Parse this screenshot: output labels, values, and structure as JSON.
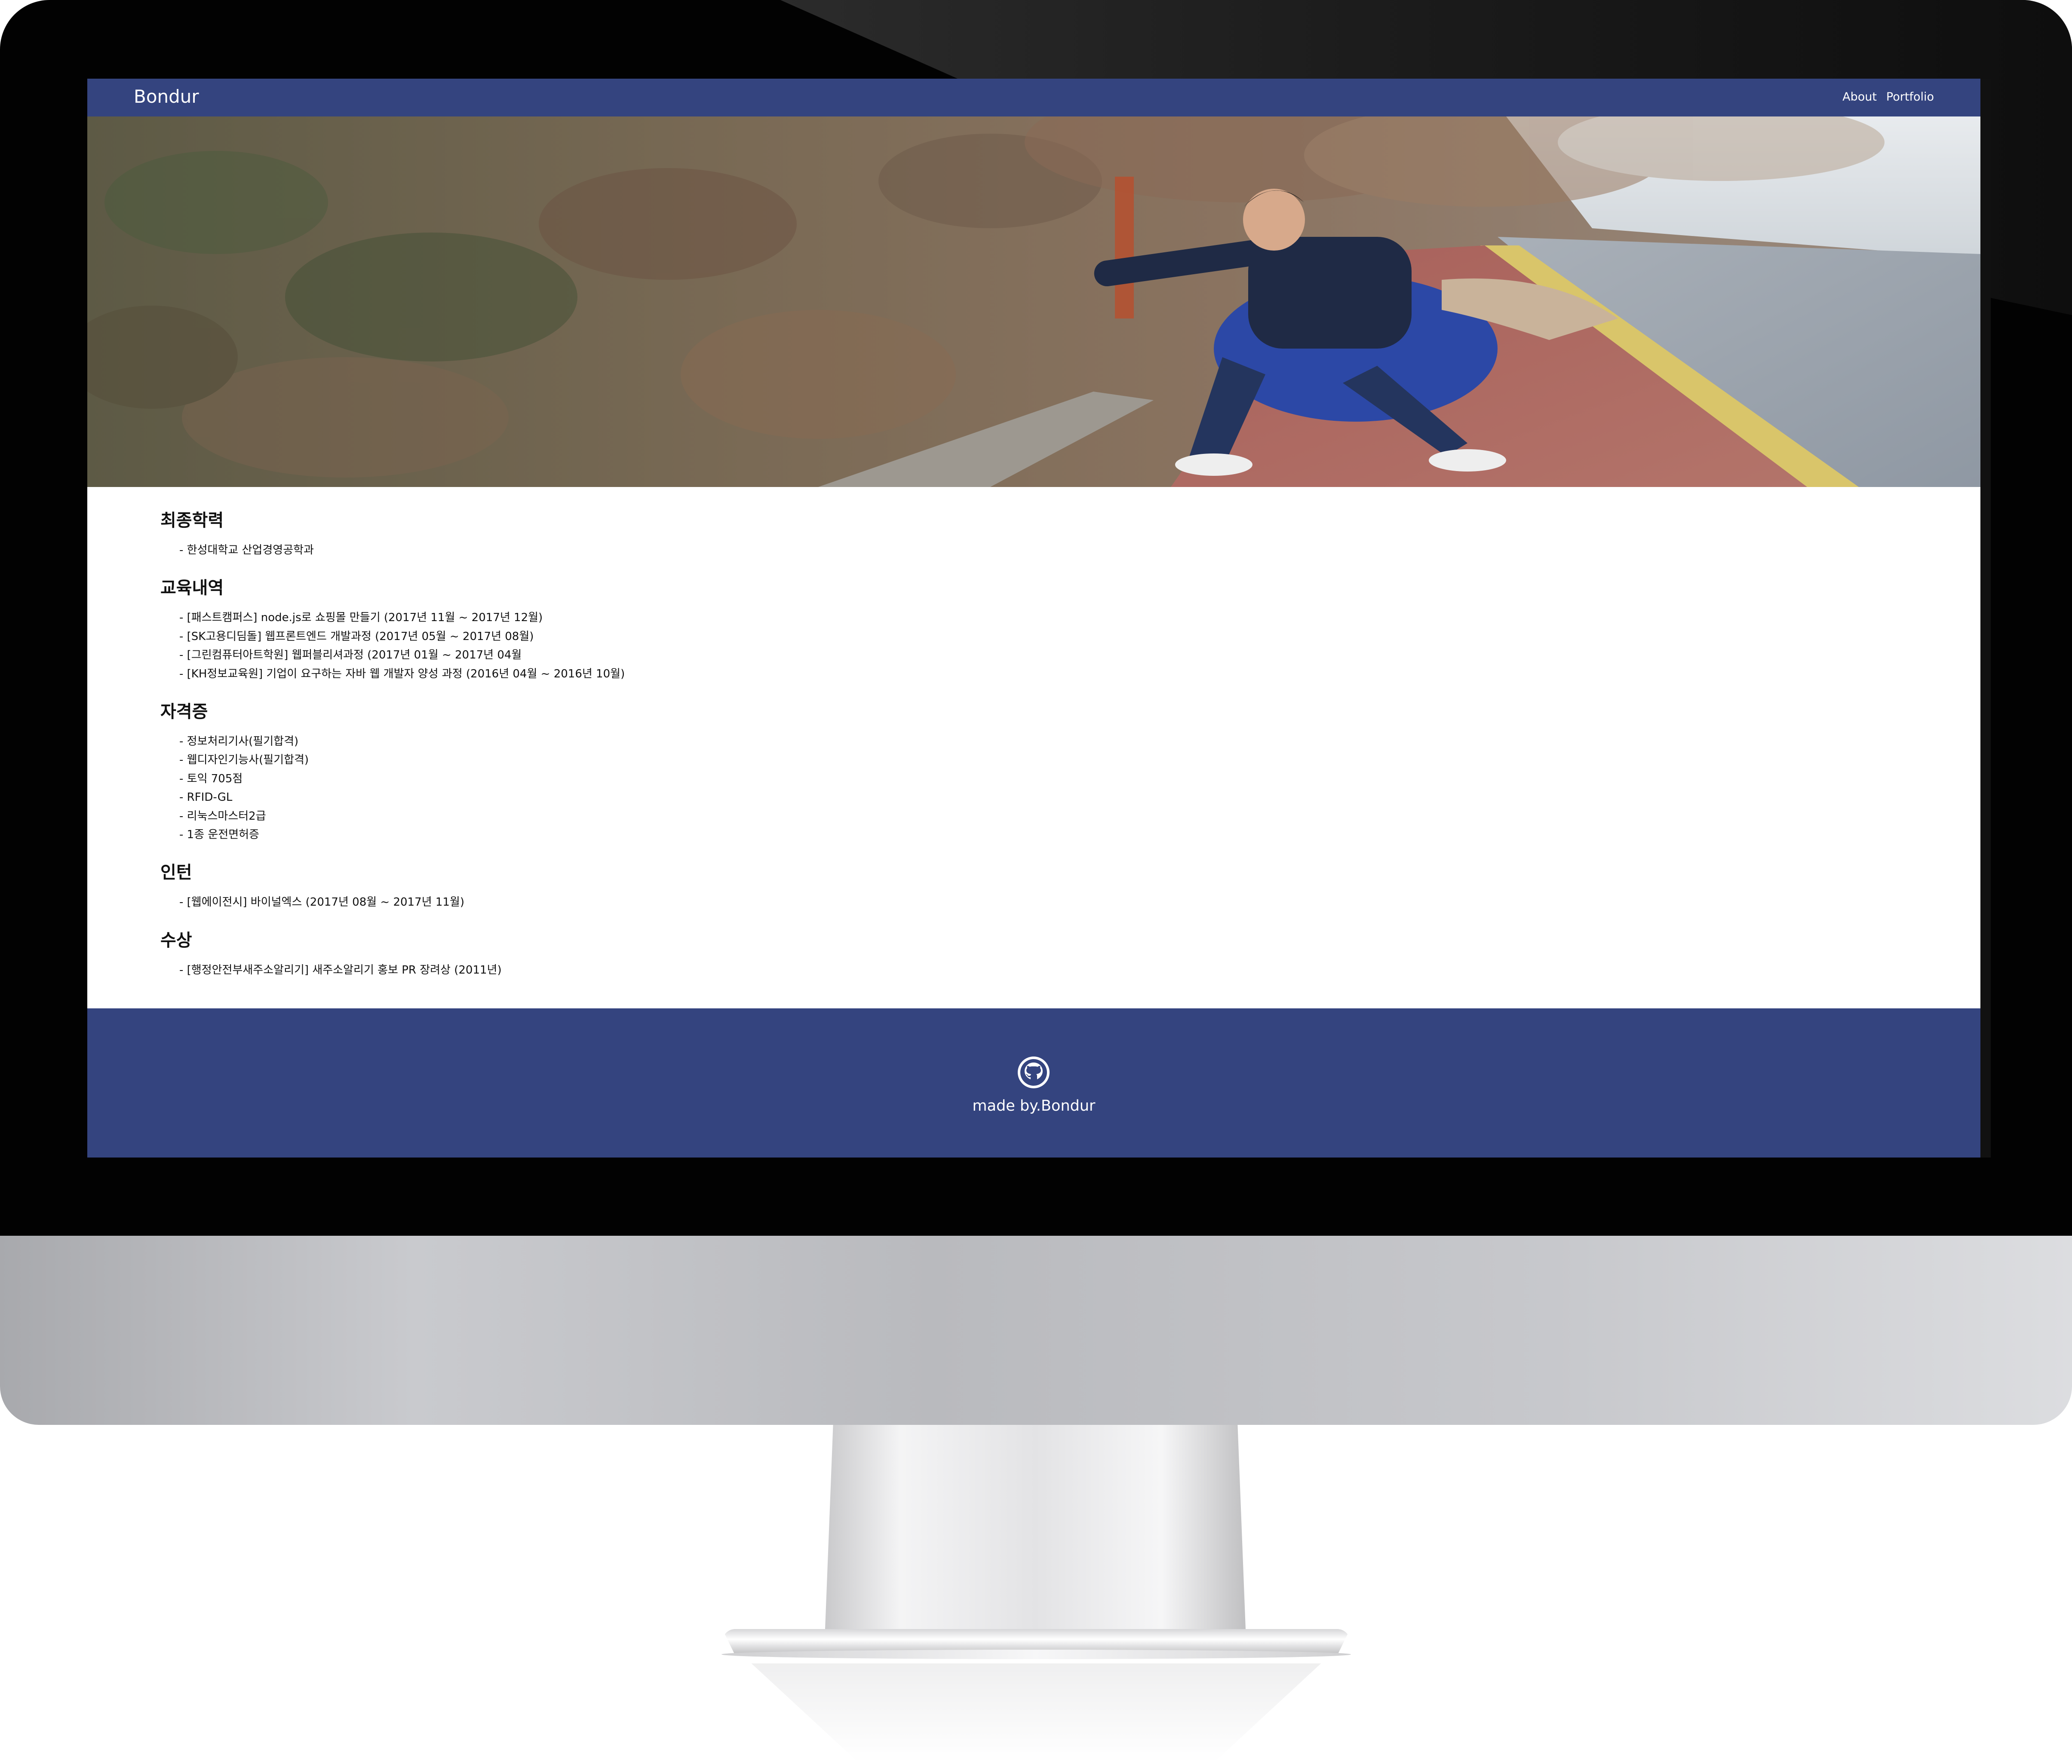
{
  "navbar": {
    "brand": "Bondur",
    "links": [
      {
        "label": "About"
      },
      {
        "label": "Portfolio"
      }
    ]
  },
  "hero": {
    "image_icon": "photo-icon"
  },
  "sections": [
    {
      "title": "최종학력",
      "items": [
        "- 한성대학교 산업경영공학과"
      ]
    },
    {
      "title": "교육내역",
      "items": [
        "- [패스트캠퍼스] node.js로 쇼핑몰 만들기 (2017년 11월 ~ 2017년 12월)",
        "- [SK고용디딤돌] 웹프론트엔드 개발과정 (2017년 05월 ~ 2017년 08월)",
        "- [그린컴퓨터아트학원] 웹퍼블리셔과정 (2017년 01월 ~ 2017년 04월",
        "- [KH정보교육원] 기업이 요구하는 자바 웹 개발자 양성 과정 (2016년 04월 ~ 2016년 10월)"
      ]
    },
    {
      "title": "자격증",
      "items": [
        "- 정보처리기사(필기합격)",
        "- 웹디자인기능사(필기합격)",
        "- 토익 705점",
        "- RFID-GL",
        "- 리눅스마스터2급",
        "- 1종 운전면허증"
      ]
    },
    {
      "title": "인턴",
      "items": [
        "- [웹에이전시] 바이널엑스 (2017년 08월 ~ 2017년 11월)"
      ]
    },
    {
      "title": "수상",
      "items": [
        "- [행정안전부새주소알리기] 새주소알리기 홍보 PR 장려상 (2011년)"
      ]
    }
  ],
  "footer": {
    "icon": "github-icon",
    "text": "made by.Bondur"
  },
  "colors": {
    "nav_bg": "#34447f",
    "footer_bg": "#34447f",
    "text": "#111111"
  }
}
